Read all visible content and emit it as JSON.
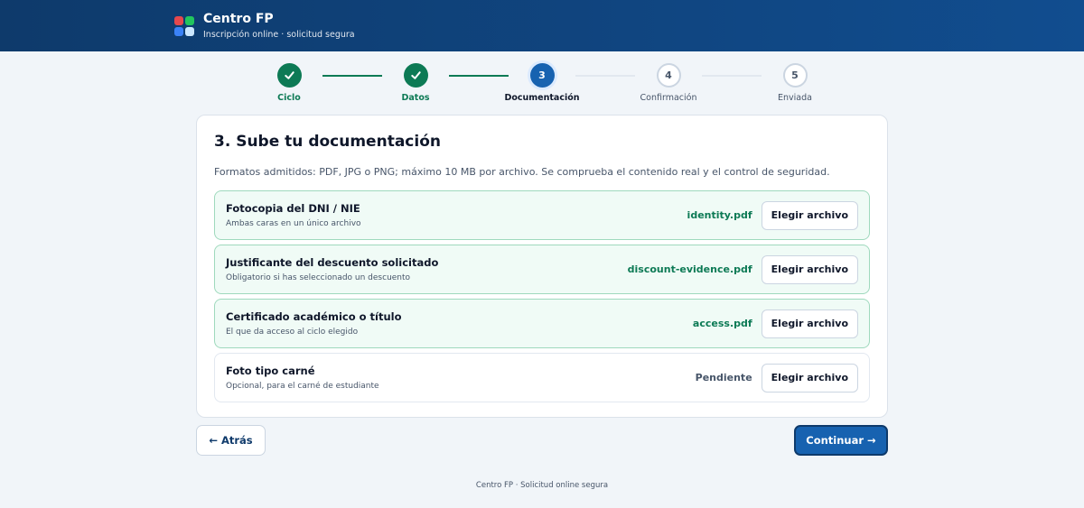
{
  "header": {
    "brand": "Centro FP",
    "tagline": "Inscripción online · solicitud segura",
    "logo_colors": [
      "#e5484d",
      "#22c55e",
      "#3b82f6",
      "#cbe7ff"
    ]
  },
  "steps": [
    {
      "number": "1",
      "label": "Ciclo",
      "state": "done",
      "icon": "check-icon"
    },
    {
      "number": "2",
      "label": "Datos",
      "state": "done",
      "icon": "check-icon"
    },
    {
      "number": "3",
      "label": "Documentación",
      "state": "active"
    },
    {
      "number": "4",
      "label": "Confirmación",
      "state": "pending"
    },
    {
      "number": "5",
      "label": "Enviada",
      "state": "pending"
    }
  ],
  "card": {
    "title": "3. Sube tu documentación",
    "description": "Formatos admitidos: PDF, JPG o PNG; máximo 10 MB por archivo. Se comprueba el contenido real y el control de seguridad.",
    "documents": [
      {
        "title": "Fotocopia del DNI / NIE",
        "subtitle": "Ambas caras en un único archivo",
        "status": "identity.pdf",
        "uploaded": true,
        "button": "Elegir archivo"
      },
      {
        "title": "Justificante del descuento solicitado",
        "subtitle": "Obligatorio si has seleccionado un descuento",
        "status": "discount-evidence.pdf",
        "uploaded": true,
        "button": "Elegir archivo"
      },
      {
        "title": "Certificado académico o título",
        "subtitle": "El que da acceso al ciclo elegido",
        "status": "access.pdf",
        "uploaded": true,
        "button": "Elegir archivo"
      },
      {
        "title": "Foto tipo carné",
        "subtitle": "Opcional, para el carné de estudiante",
        "status": "Pendiente",
        "uploaded": false,
        "button": "Elegir archivo"
      }
    ]
  },
  "nav": {
    "back_label": "← Atrás",
    "continue_label": "Continuar →"
  },
  "footer": {
    "text": "Centro FP · Solicitud online segura"
  },
  "colors": {
    "header_start": "#0e3a6b",
    "header_end": "#114d8f",
    "done": "#0d7a55",
    "active": "#1762b0",
    "uploaded_bg": "#f0fbf6"
  }
}
